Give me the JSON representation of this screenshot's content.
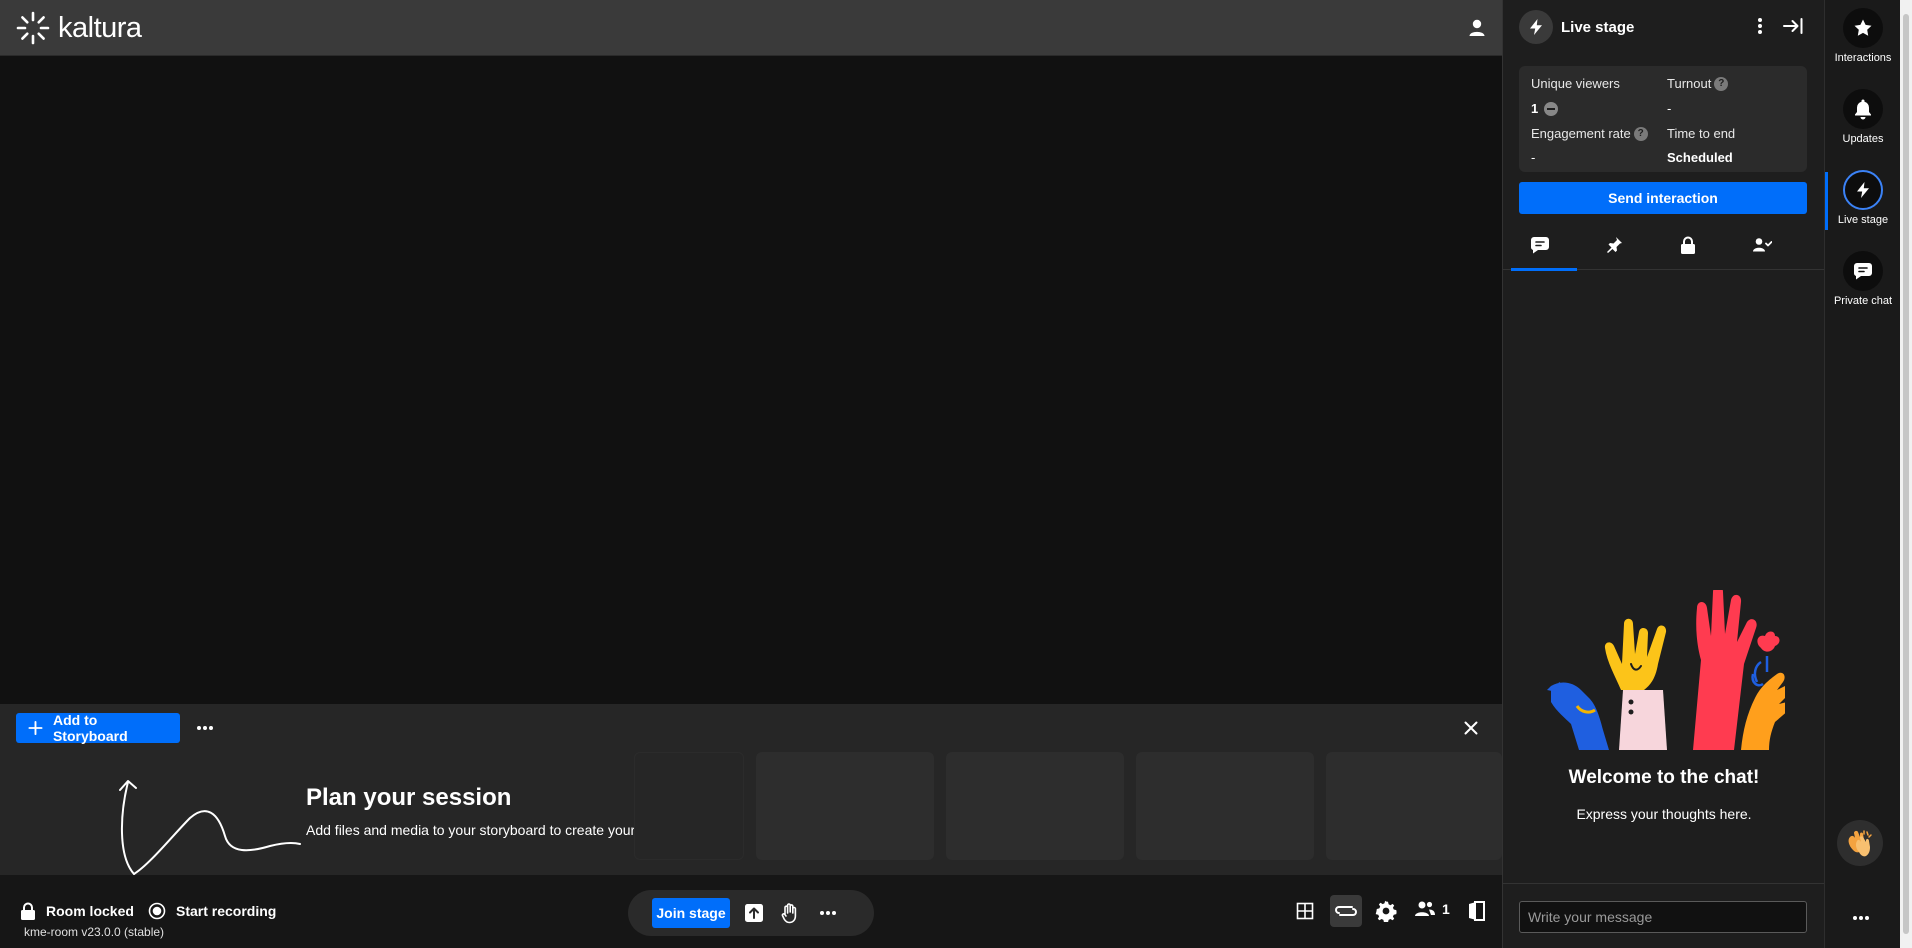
{
  "header": {
    "logo_text": "kaltura",
    "logo_icon": "kaltura-sunburst-icon",
    "user_icon": "user-icon"
  },
  "storyboard": {
    "add_label": "Add to Storyboard",
    "title": "Plan your session",
    "subtitle": "Add files and media to your storyboard to create your presentation"
  },
  "bottom_bar": {
    "room_locked_label": "Room locked",
    "start_recording_label": "Start recording",
    "version": "kme-room v23.0.0 (stable)",
    "join_stage_label": "Join stage",
    "participants_count": "1"
  },
  "panel": {
    "title": "Live stage",
    "stats": {
      "unique_viewers_label": "Unique viewers",
      "unique_viewers_value": "1",
      "turnout_label": "Turnout",
      "turnout_value": "-",
      "engagement_label": "Engagement rate",
      "engagement_value": "-",
      "time_to_end_label": "Time to end",
      "time_to_end_value": "Scheduled"
    },
    "send_interaction_label": "Send interaction",
    "tabs": [
      "chat-icon",
      "pin-icon",
      "lock-icon",
      "moderation-icon"
    ],
    "active_tab": 0,
    "welcome_title": "Welcome to the chat!",
    "welcome_subtitle": "Express your thoughts here.",
    "message_placeholder": "Write your message"
  },
  "rail": {
    "items": [
      {
        "label": "Interactions",
        "icon": "star-icon"
      },
      {
        "label": "Updates",
        "icon": "bell-icon"
      },
      {
        "label": "Live stage",
        "icon": "lightning-icon",
        "active": true
      },
      {
        "label": "Private chat",
        "icon": "chat-bubble-icon"
      }
    ]
  },
  "colors": {
    "accent": "#006efa",
    "header_bg": "#3a3a3a",
    "stage_bg": "#111111",
    "panel_bg": "#1e1e1e"
  }
}
